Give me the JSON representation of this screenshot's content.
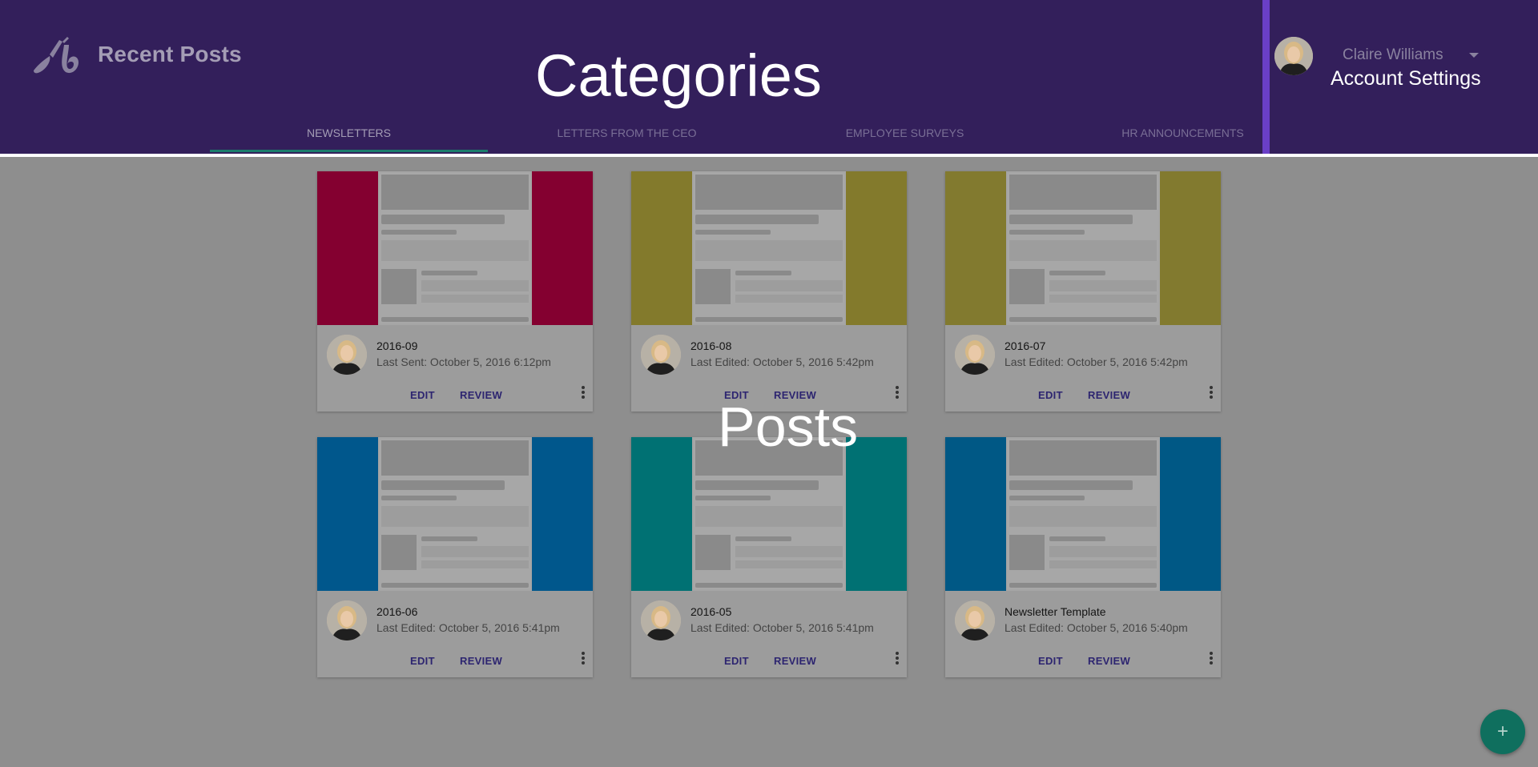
{
  "header": {
    "app_title": "Recent Posts",
    "overlay_label": "Categories",
    "tabs": [
      {
        "label": "NEWSLETTERS"
      },
      {
        "label": "LETTERS FROM THE CEO"
      },
      {
        "label": "EMPLOYEE SURVEYS"
      },
      {
        "label": "HR ANNOUNCEMENTS"
      }
    ],
    "active_tab": "NEWSLETTERS"
  },
  "account": {
    "name": "Claire Williams",
    "settings_label": "Account Settings"
  },
  "content": {
    "overlay_label": "Posts",
    "cards": [
      {
        "title": "2016-09",
        "subtitle": "Last Sent: October 5, 2016 6:12pm",
        "color": "#840030",
        "edit": "EDIT",
        "review": "REVIEW"
      },
      {
        "title": "2016-08",
        "subtitle": "Last Edited: October 5, 2016 5:42pm",
        "color": "#837a2c",
        "edit": "EDIT",
        "review": "REVIEW"
      },
      {
        "title": "2016-07",
        "subtitle": "Last Edited: October 5, 2016 5:42pm",
        "color": "#827a2f",
        "edit": "EDIT",
        "review": "REVIEW"
      },
      {
        "title": "2016-06",
        "subtitle": "Last Edited: October 5, 2016 5:41pm",
        "color": "#00578c",
        "edit": "EDIT",
        "review": "REVIEW"
      },
      {
        "title": "2016-05",
        "subtitle": "Last Edited: October 5, 2016 5:41pm",
        "color": "#007173",
        "edit": "EDIT",
        "review": "REVIEW"
      },
      {
        "title": "Newsletter Template",
        "subtitle": "Last Edited: October 5, 2016 5:40pm",
        "color": "#005885",
        "edit": "EDIT",
        "review": "REVIEW"
      }
    ]
  },
  "fab": {
    "label": "+"
  },
  "colors": {
    "header_bg": "#331f5b",
    "accent_border": "#6a3fc7",
    "tab_indicator": "#1a7c6c",
    "button_text": "#2d2570",
    "fab_bg": "#0f6f5e"
  },
  "icons": [
    "brush-logo-icon",
    "chevron-down-icon",
    "more-vert-icon",
    "plus-icon",
    "avatar"
  ]
}
